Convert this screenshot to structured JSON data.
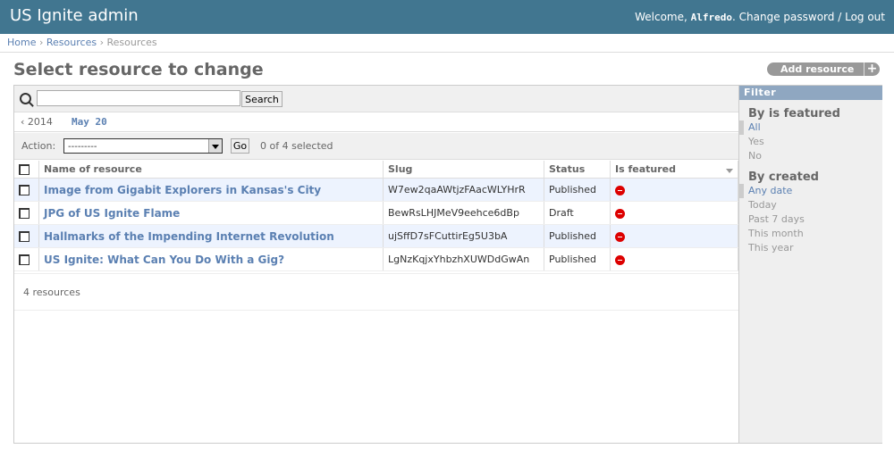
{
  "header": {
    "title": "US Ignite admin",
    "welcome": "Welcome,",
    "username": "Alfredo",
    "change_password": "Change password",
    "separator": "/",
    "logout": "Log out"
  },
  "breadcrumbs": {
    "home": "Home",
    "app": "Resources",
    "current": "Resources",
    "sep": "›"
  },
  "page": {
    "title": "Select resource to change",
    "add_button": "Add resource",
    "add_icon": "+"
  },
  "search": {
    "value": "",
    "button": "Search",
    "icon": "search-icon"
  },
  "date_hierarchy": {
    "prev": "‹ 2014",
    "current": "May 20"
  },
  "actions": {
    "label": "Action:",
    "selected": "---------",
    "go": "Go",
    "counter": "0 of 4 selected"
  },
  "table": {
    "columns": [
      "Name of resource",
      "Slug",
      "Status",
      "Is featured"
    ],
    "rows": [
      {
        "name": "Image from Gigabit Explorers in Kansas's City",
        "slug": "W7ew2qaAWtjzFAacWLYHrR",
        "status": "Published",
        "featured": "no"
      },
      {
        "name": "JPG of US Ignite Flame",
        "slug": "BewRsLHJMeV9eehce6dBp",
        "status": "Draft",
        "featured": "no"
      },
      {
        "name": "Hallmarks of the Impending Internet Revolution",
        "slug": "ujSffD7sFCuttirEg5U3bA",
        "status": "Published",
        "featured": "no"
      },
      {
        "name": "US Ignite: What Can You Do With a Gig?",
        "slug": "LgNzKqjxYhbzhXUWDdGwAn",
        "status": "Published",
        "featured": "no"
      }
    ]
  },
  "paginator": {
    "count": "4 resources"
  },
  "filter": {
    "title": "Filter",
    "groups": [
      {
        "heading": "By is featured",
        "options": [
          "All",
          "Yes",
          "No"
        ],
        "selected": 0
      },
      {
        "heading": "By created",
        "options": [
          "Any date",
          "Today",
          "Past 7 days",
          "This month",
          "This year"
        ],
        "selected": 0
      }
    ]
  },
  "colors": {
    "header_bg": "#417690",
    "link": "#5b80b2",
    "row_alt": "#edf3fe",
    "filter_header": "#8fa7c1",
    "no_icon": "#dd0000"
  }
}
